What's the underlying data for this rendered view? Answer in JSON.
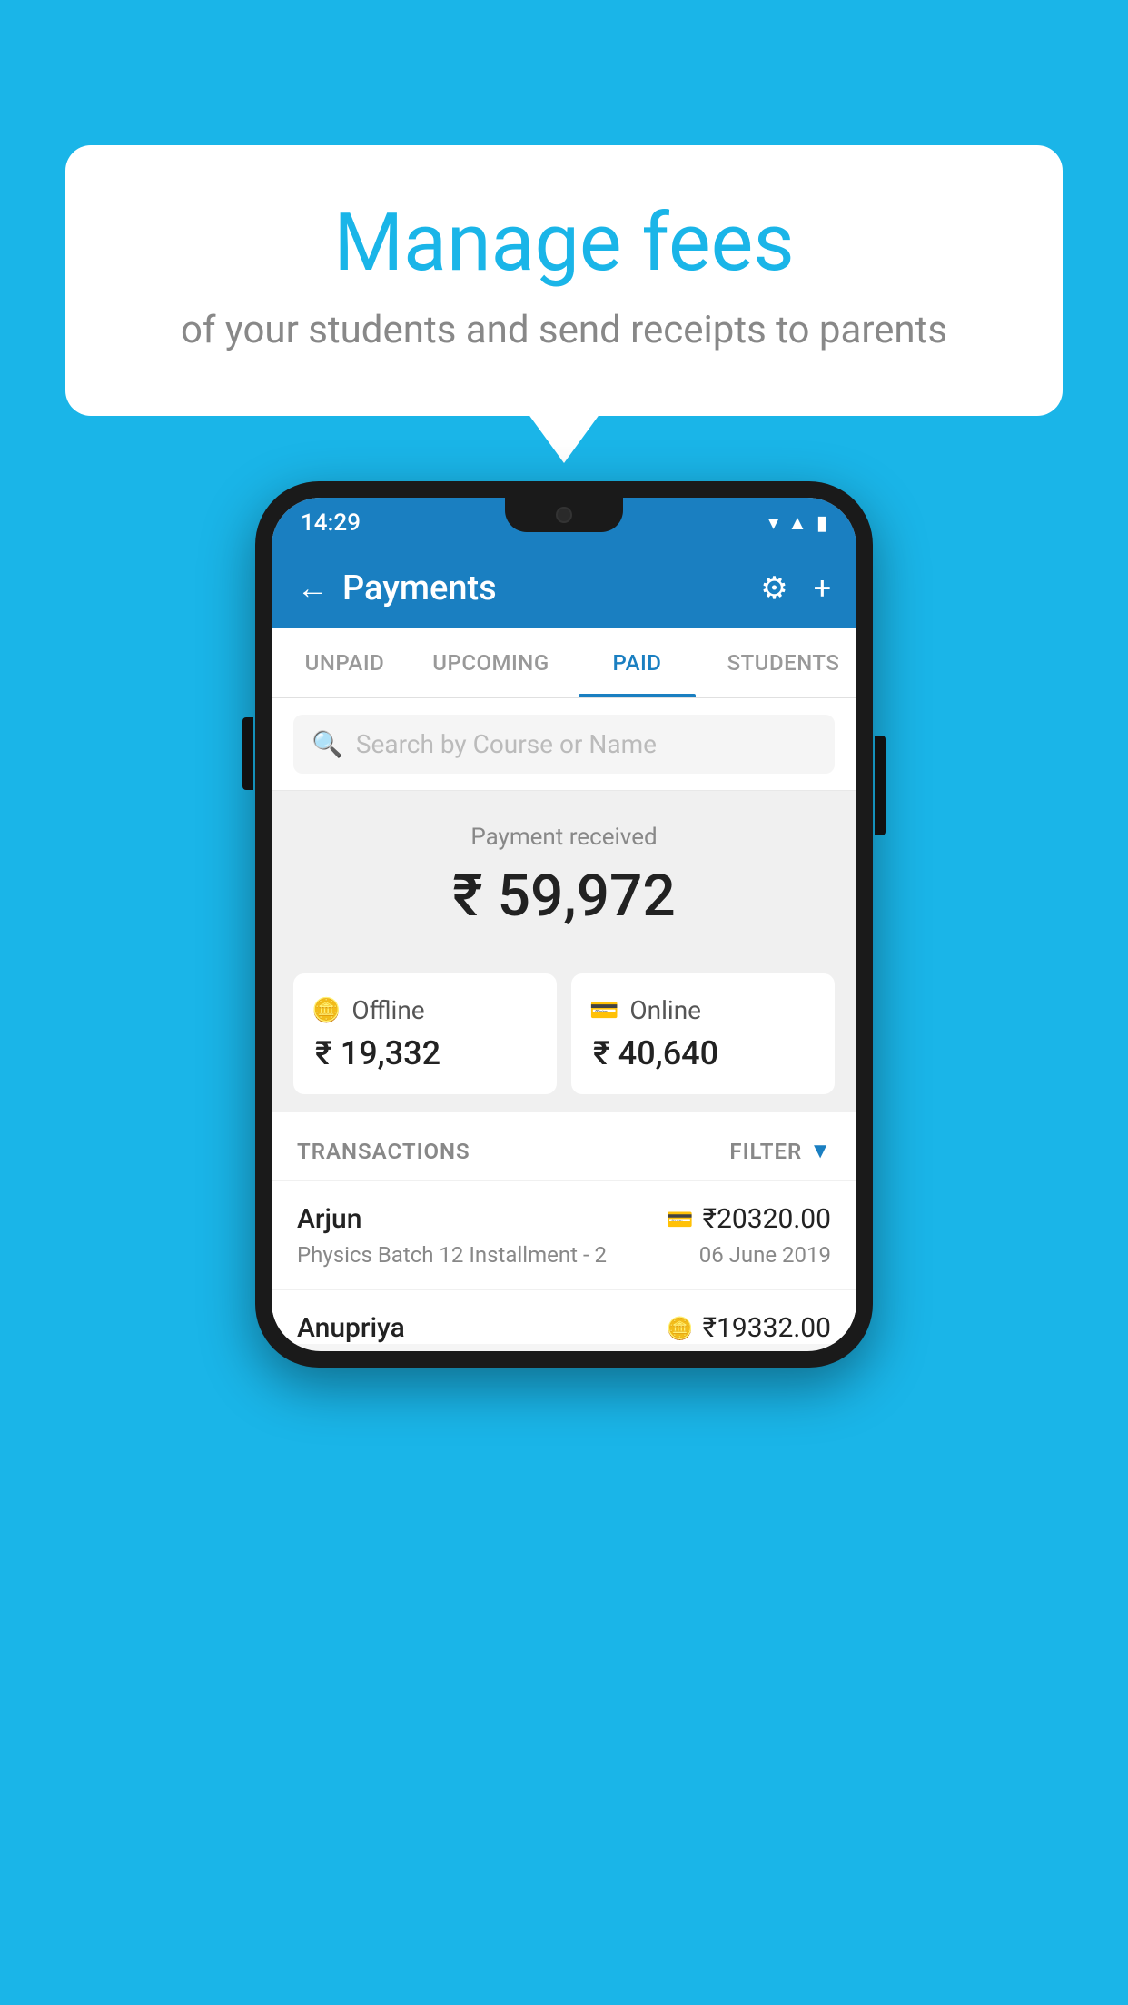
{
  "background_color": "#1ab5e8",
  "bubble": {
    "title": "Manage fees",
    "subtitle": "of your students and send receipts to parents"
  },
  "status_bar": {
    "time": "14:29",
    "wifi_icon": "▲",
    "signal_icon": "▲",
    "battery_icon": "▮"
  },
  "header": {
    "back_label": "←",
    "title": "Payments",
    "settings_icon": "⚙",
    "add_icon": "+"
  },
  "tabs": [
    {
      "label": "UNPAID",
      "active": false
    },
    {
      "label": "UPCOMING",
      "active": false
    },
    {
      "label": "PAID",
      "active": true
    },
    {
      "label": "STUDENTS",
      "active": false
    }
  ],
  "search": {
    "placeholder": "Search by Course or Name"
  },
  "payment_summary": {
    "label": "Payment received",
    "amount": "₹ 59,972"
  },
  "payment_cards": [
    {
      "icon": "💳",
      "label": "Offline",
      "amount": "₹ 19,332"
    },
    {
      "icon": "💳",
      "label": "Online",
      "amount": "₹ 40,640"
    }
  ],
  "transactions_section": {
    "label": "TRANSACTIONS",
    "filter_label": "FILTER"
  },
  "transactions": [
    {
      "name": "Arjun",
      "amount_icon": "💳",
      "amount": "₹20320.00",
      "course": "Physics Batch 12 Installment - 2",
      "date": "06 June 2019"
    },
    {
      "name": "Anupriya",
      "amount_icon": "💴",
      "amount": "₹19332.00",
      "course": "",
      "date": ""
    }
  ]
}
